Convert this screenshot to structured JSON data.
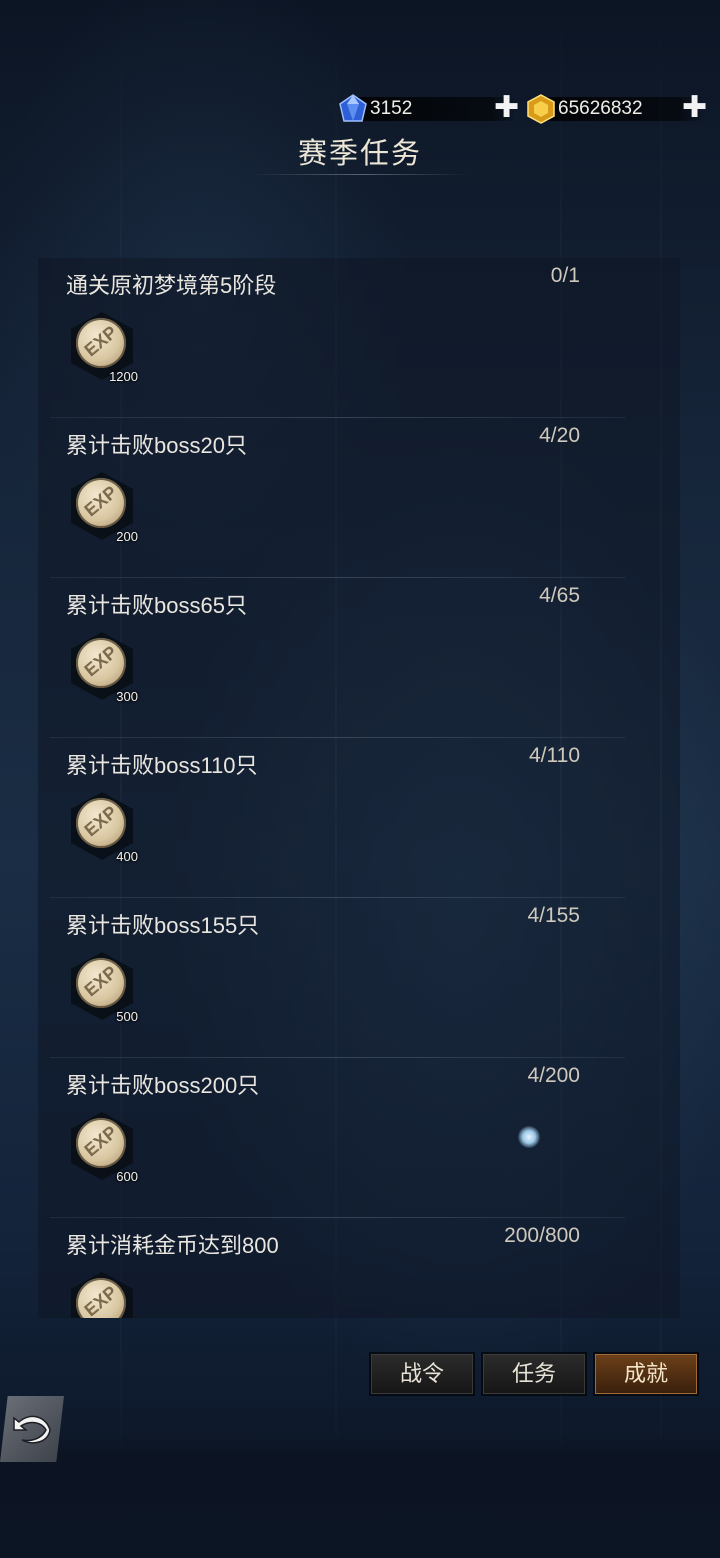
{
  "currencies": {
    "diamond": {
      "value": "3152",
      "icon": "blue-gem-icon"
    },
    "gold": {
      "value": "65626832",
      "icon": "gold-gem-icon"
    },
    "plus_glyph": "✚"
  },
  "page_title": "赛季任务",
  "tasks": [
    {
      "name": "通关原初梦境第5阶段",
      "progress": "0/1",
      "reward_amount": "1200",
      "reward_label": "EXP"
    },
    {
      "name": "累计击败boss20只",
      "progress": "4/20",
      "reward_amount": "200",
      "reward_label": "EXP"
    },
    {
      "name": "累计击败boss65只",
      "progress": "4/65",
      "reward_amount": "300",
      "reward_label": "EXP"
    },
    {
      "name": "累计击败boss110只",
      "progress": "4/110",
      "reward_amount": "400",
      "reward_label": "EXP"
    },
    {
      "name": "累计击败boss155只",
      "progress": "4/155",
      "reward_amount": "500",
      "reward_label": "EXP"
    },
    {
      "name": "累计击败boss200只",
      "progress": "4/200",
      "reward_amount": "600",
      "reward_label": "EXP"
    },
    {
      "name": "累计消耗金币达到800",
      "progress": "200/800",
      "reward_amount": "",
      "reward_label": "EXP"
    }
  ],
  "tabs": [
    {
      "label": "战令",
      "active": false
    },
    {
      "label": "任务",
      "active": false
    },
    {
      "label": "成就",
      "active": true
    }
  ],
  "colors": {
    "background": "#16253a",
    "active_tab": "#6b3f19",
    "text": "#e9e6df"
  }
}
